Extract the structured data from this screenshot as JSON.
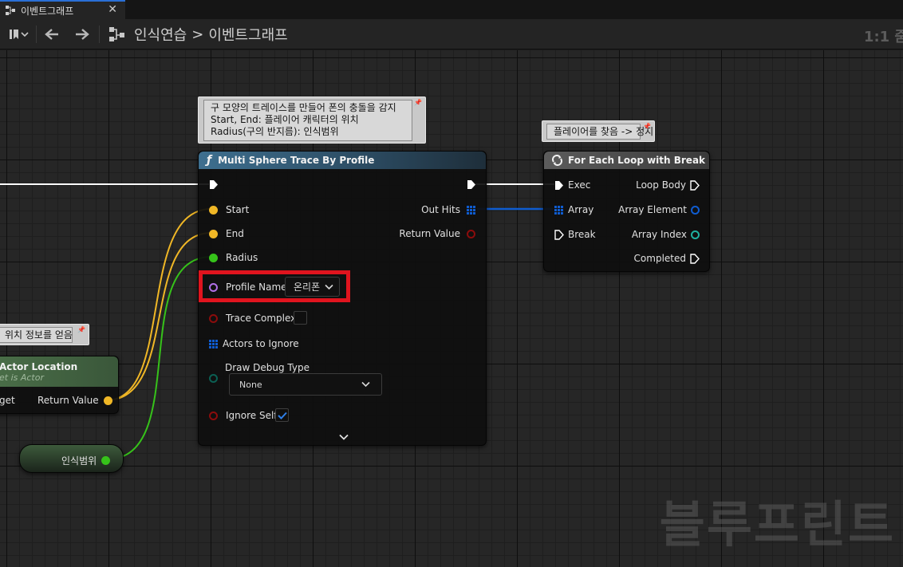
{
  "tab": {
    "title": "이벤트그래프",
    "close": "✕"
  },
  "toolbar": {
    "breadcrumb": [
      "인식연습",
      "이벤트그래프"
    ],
    "separator": ">",
    "zoom": "1:1 줌"
  },
  "comments": {
    "trace": [
      "구 모양의 트레이스를 만들어 폰의 충돌을 감지",
      "Start, End: 플레이어 캐릭터의 위치",
      "Radius(구의 반지름): 인식범위"
    ],
    "loop": "플레이어를 찾음 -> 정지",
    "location": "위치 정보를 얻음"
  },
  "trace_node": {
    "icon": "ƒ",
    "title": "Multi Sphere Trace By Profile",
    "pins": {
      "start": "Start",
      "end": "End",
      "radius": "Radius",
      "profile_name": "Profile Name",
      "profile_value": "온리폰",
      "trace_complex": "Trace Complex",
      "actors_to_ignore": "Actors to Ignore",
      "draw_debug_type": "Draw Debug Type",
      "draw_debug_value": "None",
      "ignore_self": "Ignore Self",
      "out_hits": "Out Hits",
      "return_value": "Return Value"
    }
  },
  "loop_node": {
    "title": "For Each Loop with Break",
    "pins": {
      "exec": "Exec",
      "array": "Array",
      "break": "Break",
      "loop_body": "Loop Body",
      "array_element": "Array Element",
      "array_index": "Array Index",
      "completed": "Completed"
    }
  },
  "location_node": {
    "title": "Actor Location",
    "subtitle": "et is Actor",
    "target": "get",
    "return_value": "Return Value"
  },
  "variable_node": {
    "label": "인식범위"
  },
  "watermark": "블루프린트",
  "colors": {
    "exec": "#ffffff",
    "vector": "#f0b726",
    "float": "#36c21a",
    "name": "#b070e6",
    "boolean": "#8b0c0c",
    "struct": "#0f5cd0",
    "enum": "#0b5f53",
    "highlight": "#e0141e"
  }
}
